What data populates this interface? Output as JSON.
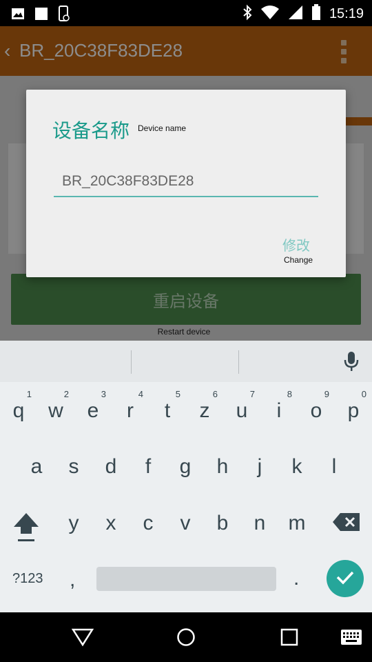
{
  "status_bar": {
    "time": "15:19",
    "left_icons": [
      "image-icon",
      "square-icon",
      "phone-icon"
    ],
    "right_icons": [
      "bluetooth-icon",
      "wifi-icon",
      "signal-icon",
      "battery-icon"
    ]
  },
  "app_bar": {
    "back_glyph": "‹",
    "title": "BR_20C38F83DE28"
  },
  "background": {
    "restart_label": "重启设备",
    "restart_subtitle": "Restart device"
  },
  "dialog": {
    "title": "设备名称",
    "title_subtitle": "Device name",
    "input_value": "BR_20C38F83DE28",
    "action_label": "修改",
    "action_subtitle": "Change"
  },
  "keyboard": {
    "row1": [
      {
        "key": "q",
        "hint": "1"
      },
      {
        "key": "w",
        "hint": "2"
      },
      {
        "key": "e",
        "hint": "3"
      },
      {
        "key": "r",
        "hint": "4"
      },
      {
        "key": "t",
        "hint": "5"
      },
      {
        "key": "z",
        "hint": "6"
      },
      {
        "key": "u",
        "hint": "7"
      },
      {
        "key": "i",
        "hint": "8"
      },
      {
        "key": "o",
        "hint": "9"
      },
      {
        "key": "p",
        "hint": "0"
      }
    ],
    "row2": [
      "a",
      "s",
      "d",
      "f",
      "g",
      "h",
      "j",
      "k",
      "l"
    ],
    "row3": [
      "y",
      "x",
      "c",
      "v",
      "b",
      "n",
      "m"
    ],
    "symbols_label": "?123",
    "comma": ",",
    "period": "."
  },
  "colors": {
    "app_bar": "#c06412",
    "accent": "#1a9a8a",
    "restart_button": "#4e8c4e",
    "enter_key": "#26a69a"
  }
}
